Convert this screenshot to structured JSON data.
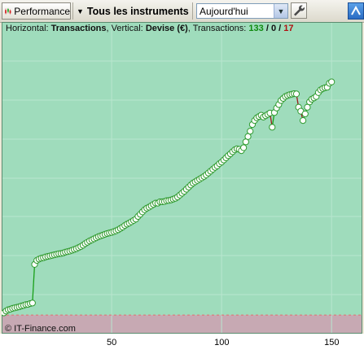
{
  "toolbar": {
    "performance_label": "Performance",
    "instruments_label": "Tous les instruments",
    "period_value": "Aujourd'hui",
    "icons": [
      "candlestick-chart-icon",
      "chevron-down-icon",
      "wrench-icon",
      "panel-toggle-icon"
    ]
  },
  "header": {
    "horizontal_label": "Horizontal:",
    "horizontal_value": "Transactions",
    "vertical_label": ", Vertical:",
    "vertical_value": "Devise (€)",
    "transactions_label": ", Transactions:",
    "tx_win": "133",
    "tx_sep1": " / ",
    "tx_neutral": "0",
    "tx_sep2": " / ",
    "tx_loss": "17"
  },
  "copyright": "© IT-Finance.com",
  "colors": {
    "positive_area": "#9fdcbc",
    "negative_area": "#c7a9b3",
    "line_up": "#18a018",
    "line_down": "#9b1b1b",
    "marker_fill": "#ffffff",
    "marker_stroke": "#2e9a2e"
  },
  "chart_data": {
    "type": "line",
    "x_ticks": [
      "50",
      "100",
      "150"
    ],
    "xlim": [
      0,
      164
    ],
    "ylim": [
      -7,
      110
    ],
    "zero_line": 0,
    "grid": true,
    "series": [
      {
        "values": [
          0.8,
          1.5,
          2,
          2.2,
          2.5,
          2.7,
          2.9,
          3.1,
          3.4,
          3.6,
          3.9,
          4,
          4.3,
          4.5,
          19,
          20.5,
          21,
          21.3,
          21.5,
          21.8,
          22,
          22.2,
          22.4,
          22.6,
          22.8,
          23,
          23.1,
          23.3,
          23.6,
          23.8,
          24,
          24.3,
          24.6,
          24.9,
          25.3,
          25.7,
          26.2,
          26.8,
          27.3,
          27.8,
          28.2,
          28.6,
          29,
          29.4,
          29.7,
          30,
          30.3,
          30.6,
          30.8,
          31,
          31.3,
          31.6,
          32,
          32.5,
          33,
          33.6,
          34.1,
          34.5,
          35,
          35.5,
          36,
          37,
          37.8,
          38.7,
          39.5,
          40.1,
          40.5,
          41,
          41.5,
          42,
          42,
          42.5,
          42.5,
          42.6,
          42.9,
          43,
          43.2,
          43.5,
          43.8,
          44.3,
          45,
          45.7,
          46.4,
          47.2,
          48,
          48.8,
          49.5,
          50,
          50.5,
          51,
          51.5,
          52,
          52.6,
          53.3,
          54,
          54.7,
          55.4,
          56,
          56.8,
          57.4,
          58.2,
          59,
          59.8,
          60.5,
          61.3,
          62,
          62.4,
          62.2,
          61.7,
          62.8,
          65,
          67,
          69,
          71.5,
          73,
          74,
          74.5,
          75,
          74.3,
          74.8,
          75.3,
          75.8,
          70.5,
          76,
          77.7,
          79,
          80.5,
          81.3,
          82,
          82.4,
          82.7,
          82.9,
          83.1,
          83,
          78,
          76.5,
          73,
          75.5,
          78,
          80,
          81,
          81.5,
          82,
          83.5,
          84.5,
          85,
          85.3,
          85.5,
          87,
          87.5
        ]
      }
    ]
  }
}
